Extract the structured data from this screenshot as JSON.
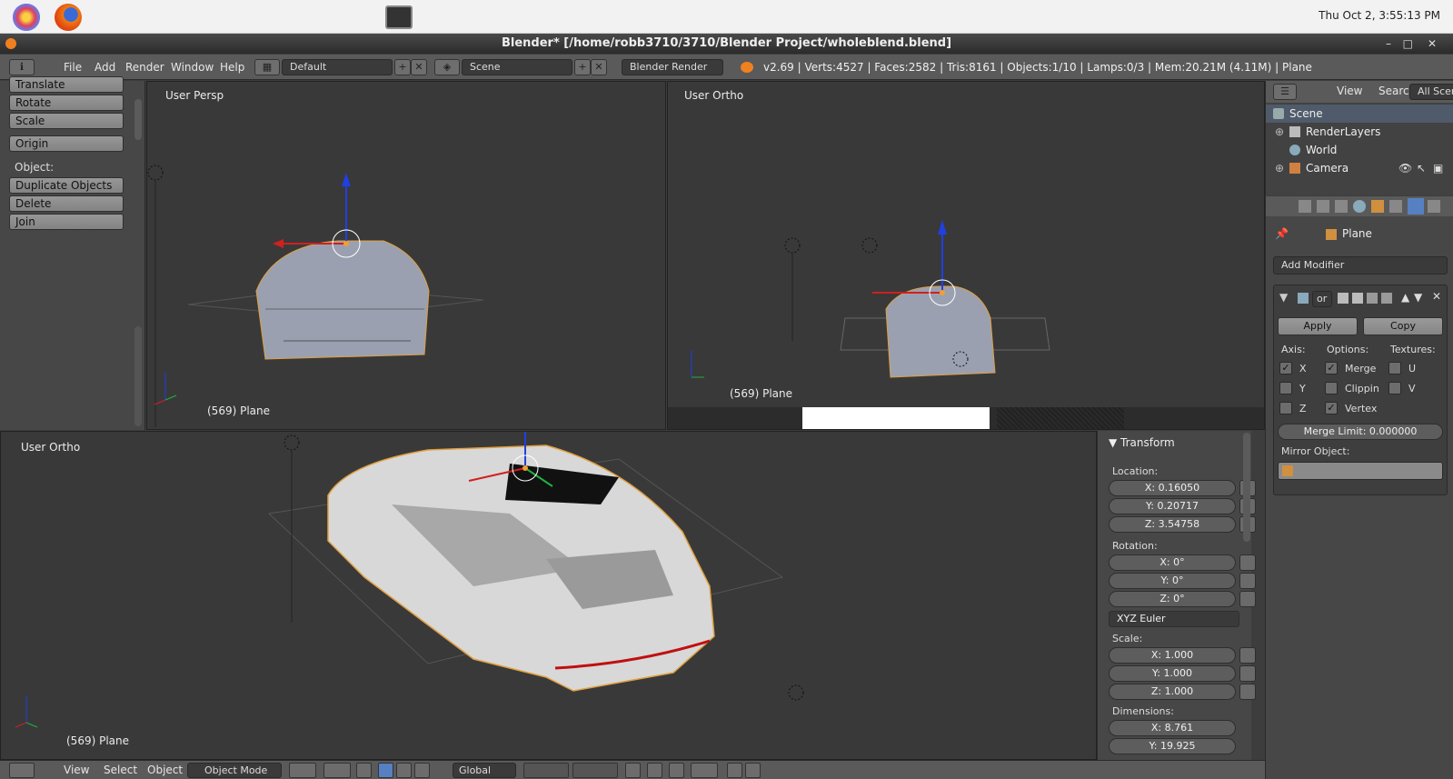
{
  "os": {
    "clock": "Thu Oct  2,  3:55:13 PM"
  },
  "window": {
    "title": "Blender* [/home/robb3710/3710/Blender Project/wholeblend.blend]"
  },
  "info": {
    "menus": [
      "File",
      "Add",
      "Render",
      "Window",
      "Help"
    ],
    "layout": "Default",
    "scene": "Scene",
    "engine": "Blender Render",
    "stats": "v2.69 | Verts:4527 | Faces:2582 | Tris:8161 | Objects:1/10 | Lamps:0/3 | Mem:20.21M (4.11M) | Plane"
  },
  "toolshelf": {
    "buttons": [
      "Translate",
      "Rotate",
      "Scale",
      "Origin"
    ],
    "object_label": "Object:",
    "object_buttons": [
      "Duplicate Objects",
      "Delete",
      "Join"
    ]
  },
  "viewports": {
    "top_left": {
      "label": "User Persp",
      "object": "(569) Plane"
    },
    "top_right": {
      "label": "User Ortho",
      "object": "(569) Plane"
    },
    "bottom": {
      "label": "User Ortho",
      "object": "(569) Plane"
    }
  },
  "transform": {
    "title": "▼ Transform",
    "location_label": "Location:",
    "location": [
      "X: 0.16050",
      "Y: 0.20717",
      "Z: 3.54758"
    ],
    "rotation_label": "Rotation:",
    "rotation": [
      "X: 0°",
      "Y: 0°",
      "Z: 0°"
    ],
    "rotation_mode": "XYZ Euler",
    "scale_label": "Scale:",
    "scale": [
      "X: 1.000",
      "Y: 1.000",
      "Z: 1.000"
    ],
    "dimensions_label": "Dimensions:",
    "dimensions": [
      "X: 8.761",
      "Y: 19.925"
    ]
  },
  "outliner": {
    "menus": [
      "View",
      "Search"
    ],
    "filter": "All Scene",
    "items": [
      "Scene",
      "RenderLayers",
      "World",
      "Camera"
    ]
  },
  "properties": {
    "object_name": "Plane",
    "add_modifier": "Add Modifier",
    "mod_name": "or",
    "apply": "Apply",
    "copy": "Copy",
    "axis_label": "Axis:",
    "options_label": "Options:",
    "textures_label": "Textures:",
    "axis": [
      "X",
      "Y",
      "Z"
    ],
    "axis_checked": [
      true,
      false,
      false
    ],
    "options": [
      "Merge",
      "Clippin",
      "Vertex"
    ],
    "options_checked": [
      true,
      false,
      true
    ],
    "textures": [
      "U",
      "V"
    ],
    "merge_limit": "Merge Limit: 0.000000",
    "mirror_object_label": "Mirror Object:"
  },
  "bottom_header": {
    "menus": [
      "View",
      "Select",
      "Object"
    ],
    "mode": "Object Mode",
    "orientation": "Global"
  },
  "colors": {
    "accent": "#5680c2",
    "selection": "#f0a030",
    "x_axis": "#d02020",
    "y_axis": "#20b040",
    "z_axis": "#2040e0"
  }
}
